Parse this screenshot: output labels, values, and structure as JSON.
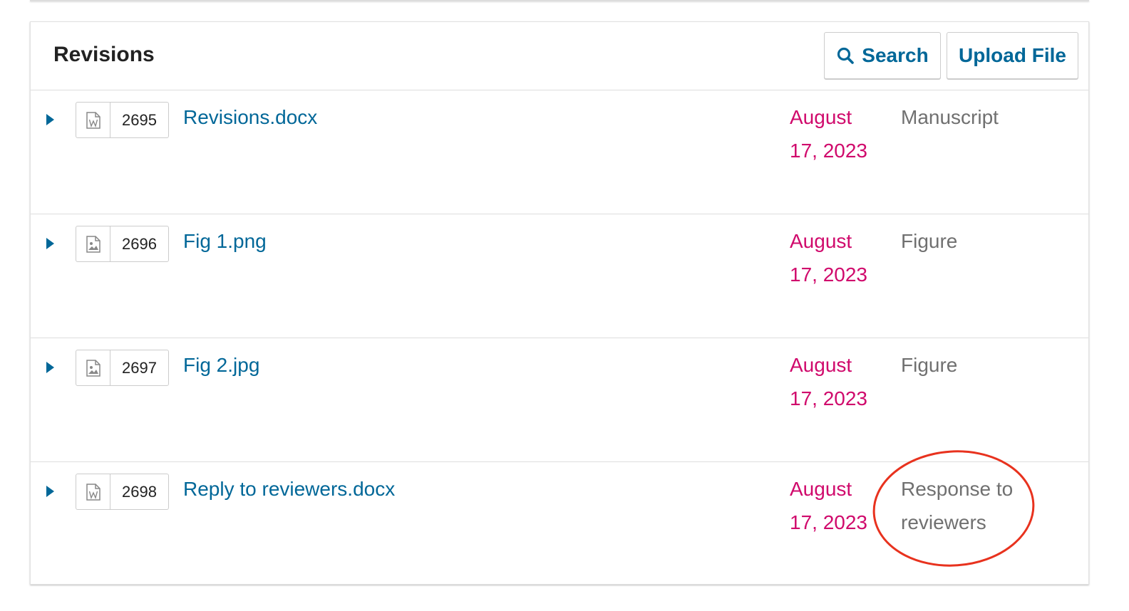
{
  "panel": {
    "title": "Revisions",
    "search_button_label": "Search",
    "upload_button_label": "Upload File"
  },
  "files": [
    {
      "id": "2695",
      "name": "Revisions.docx",
      "icon": "word-document-icon",
      "date": "August 17, 2023",
      "type": "Manuscript"
    },
    {
      "id": "2696",
      "name": "Fig 1.png",
      "icon": "image-file-icon",
      "date": "August 17, 2023",
      "type": "Figure"
    },
    {
      "id": "2697",
      "name": "Fig 2.jpg",
      "icon": "image-file-icon",
      "date": "August 17, 2023",
      "type": "Figure"
    },
    {
      "id": "2698",
      "name": "Reply to reviewers.docx",
      "icon": "word-document-icon",
      "date": "August 17, 2023",
      "type": "Response to reviewers"
    }
  ],
  "colors": {
    "link": "#006798",
    "date": "#d00a6c",
    "muted": "#707070",
    "annotation": "#e8321e"
  }
}
